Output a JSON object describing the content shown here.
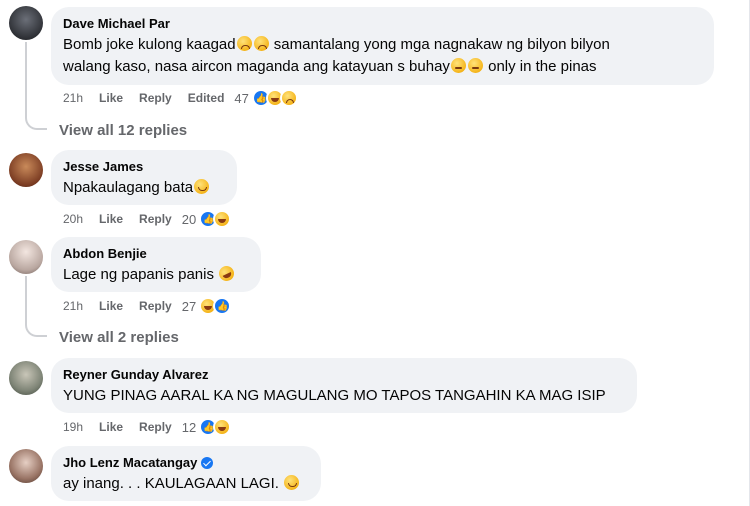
{
  "comments": [
    {
      "author": "Dave Michael Par",
      "text_lines": [
        "Bomb joke kulong kaagad",
        " samantalang yong mga nagnakaw ng bilyon bilyon",
        "walang kaso, nasa aircon maganda ang katayuan s buhay",
        " only in the pinas"
      ],
      "time": "21h",
      "like": "Like",
      "reply": "Reply",
      "edited": "Edited",
      "reaction_count": "47",
      "reactions": [
        "like-icon",
        "haha-icon",
        "sad-icon"
      ],
      "view_replies": "View all 12 replies"
    },
    {
      "author": "Jesse James",
      "text": "Npakaulagang bata",
      "time": "20h",
      "like": "Like",
      "reply": "Reply",
      "reaction_count": "20",
      "reactions": [
        "like-icon",
        "haha-icon"
      ]
    },
    {
      "author": "Abdon Benjie",
      "text": "Lage ng papanis panis",
      "time": "21h",
      "like": "Like",
      "reply": "Reply",
      "reaction_count": "27",
      "reactions": [
        "haha-icon",
        "like-icon"
      ],
      "view_replies": "View all 2 replies"
    },
    {
      "author": "Reyner Gunday Alvarez",
      "text": "YUNG PINAG AARAL KA NG MAGULANG MO TAPOS TANGAHIN KA MAG ISIP",
      "time": "19h",
      "like": "Like",
      "reply": "Reply",
      "reaction_count": "12",
      "reactions": [
        "like-icon",
        "haha-icon"
      ]
    },
    {
      "author": "Jho Lenz Macatangay",
      "text": "ay inang. . . KAULAGAAN LAGI. ",
      "verified": true
    }
  ],
  "colors": {
    "bubble": "#f0f2f5",
    "meta_text": "#65676b",
    "like_blue": "#1877f2",
    "thread_line": "#ced0d4"
  }
}
